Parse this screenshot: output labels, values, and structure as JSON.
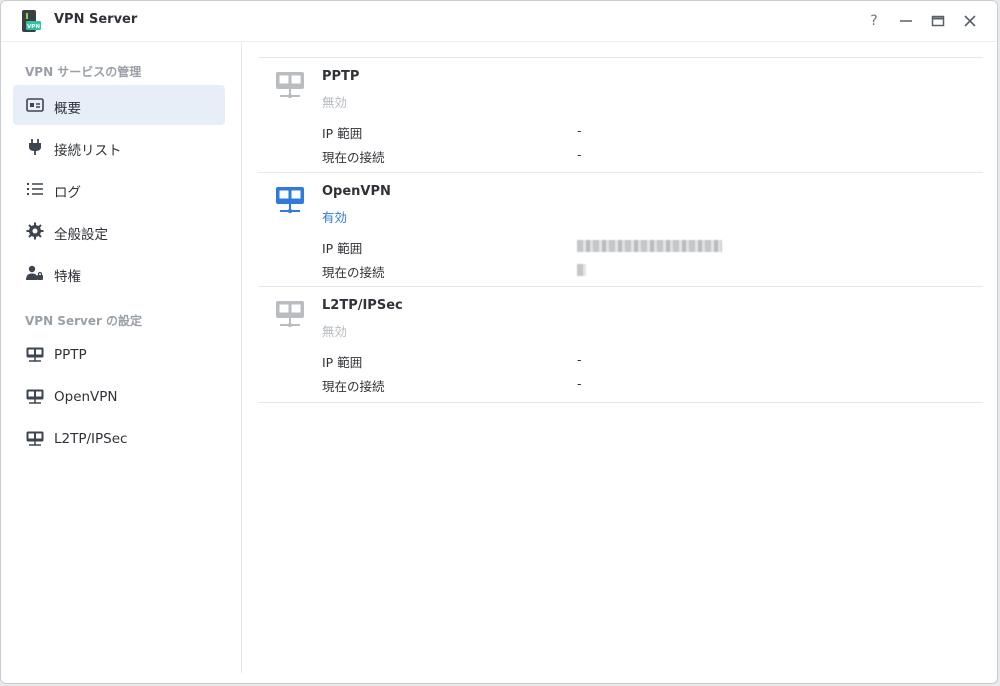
{
  "window": {
    "title": "VPN Server",
    "app_icon_text": "VPN",
    "help_label": "?"
  },
  "sidebar": {
    "section1_title": "VPN サービスの管理",
    "section1_items": [
      {
        "label": "概要",
        "icon": "overview-card-icon",
        "active": true
      },
      {
        "label": "接続リスト",
        "icon": "plug-icon",
        "active": false
      },
      {
        "label": "ログ",
        "icon": "list-icon",
        "active": false
      },
      {
        "label": "全般設定",
        "icon": "gear-icon",
        "active": false
      },
      {
        "label": "特権",
        "icon": "user-lock-icon",
        "active": false
      }
    ],
    "section2_title": "VPN Server の設定",
    "section2_items": [
      {
        "label": "PPTP",
        "icon": "network-icon"
      },
      {
        "label": "OpenVPN",
        "icon": "network-icon"
      },
      {
        "label": "L2TP/IPSec",
        "icon": "network-icon"
      }
    ]
  },
  "services": [
    {
      "name": "PPTP",
      "status": "無効",
      "enabled": false,
      "ip_range_label": "IP 範囲",
      "ip_range_value": "-",
      "connections_label": "現在の接続",
      "connections_value": "-"
    },
    {
      "name": "OpenVPN",
      "status": "有効",
      "enabled": true,
      "ip_range_label": "IP 範囲",
      "ip_range_value": "",
      "connections_label": "現在の接続",
      "connections_value": ""
    },
    {
      "name": "L2TP/IPSec",
      "status": "無効",
      "enabled": false,
      "ip_range_label": "IP 範囲",
      "ip_range_value": "-",
      "connections_label": "現在の接続",
      "connections_value": "-"
    }
  ],
  "colors": {
    "accent": "#2f7bd8",
    "disabled": "#b6bbc1",
    "active_bg": "#e7eef8"
  }
}
